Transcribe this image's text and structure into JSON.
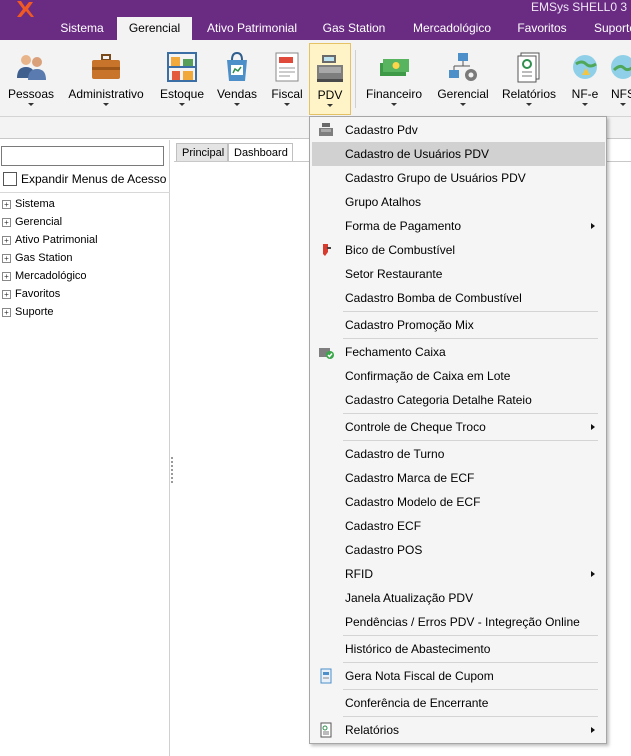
{
  "window": {
    "title": "EMSys SHELL0 3"
  },
  "tabs": [
    {
      "label": "Sistema",
      "active": false
    },
    {
      "label": "Gerencial",
      "active": true
    },
    {
      "label": "Ativo Patrimonial",
      "active": false
    },
    {
      "label": "Gas Station",
      "active": false
    },
    {
      "label": "Mercadológico",
      "active": false
    },
    {
      "label": "Favoritos",
      "active": false
    },
    {
      "label": "Suporte",
      "active": false
    }
  ],
  "ribbon": [
    {
      "label": "Pessoas",
      "icon": "people-icon"
    },
    {
      "label": "Administrativo",
      "icon": "briefcase-icon"
    },
    {
      "label": "Estoque",
      "icon": "shelves-icon"
    },
    {
      "label": "Vendas",
      "icon": "sales-bag-icon"
    },
    {
      "label": "Fiscal",
      "icon": "tax-document-icon"
    },
    {
      "label": "PDV",
      "icon": "cash-register-icon",
      "selected": true
    },
    {
      "label": "Financeiro",
      "icon": "money-icon"
    },
    {
      "label": "Gerencial",
      "icon": "network-gear-icon"
    },
    {
      "label": "Relatórios",
      "icon": "report-icon"
    },
    {
      "label": "NF-e",
      "icon": "nfe-icon"
    },
    {
      "label": "NFS",
      "icon": "nfs-icon"
    }
  ],
  "left_panel": {
    "search_value": "",
    "expand_label": "Expandir Menus de Acesso",
    "tree": [
      "Sistema",
      "Gerencial",
      "Ativo Patrimonial",
      "Gas Station",
      "Mercadológico",
      "Favoritos",
      "Suporte"
    ]
  },
  "doc_tabs": [
    "Principal",
    "Dashboard"
  ],
  "pdv_menu": [
    {
      "label": "Cadastro Pdv",
      "icon": "cash-register-icon"
    },
    {
      "label": "Cadastro de Usuários PDV",
      "highlighted": true
    },
    {
      "label": "Cadastro Grupo de Usuários PDV"
    },
    {
      "label": "Grupo Atalhos"
    },
    {
      "label": "Forma de Pagamento",
      "submenu": true
    },
    {
      "label": "Bico de Combustível",
      "icon": "fuel-nozzle-icon"
    },
    {
      "label": "Setor Restaurante"
    },
    {
      "label": "Cadastro Bomba de Combustível"
    },
    {
      "label": "Cadastro Promoção Mix"
    },
    {
      "label": "Fechamento Caixa",
      "icon": "register-check-icon"
    },
    {
      "label": "Confirmação de Caixa em Lote"
    },
    {
      "label": "Cadastro Categoria Detalhe Rateio"
    },
    {
      "label": "Controle de Cheque Troco",
      "submenu": true
    },
    {
      "label": "Cadastro de Turno"
    },
    {
      "label": "Cadastro Marca de ECF"
    },
    {
      "label": "Cadastro Modelo de ECF"
    },
    {
      "label": "Cadastro ECF"
    },
    {
      "label": "Cadastro POS"
    },
    {
      "label": "RFID",
      "submenu": true
    },
    {
      "label": "Janela Atualização PDV"
    },
    {
      "label": "Pendências / Erros PDV - Integreção Online"
    },
    {
      "label": "Histórico de Abastecimento"
    },
    {
      "label": "Gera Nota Fiscal de Cupom",
      "icon": "receipt-icon"
    },
    {
      "label": "Conferência de Encerrante"
    },
    {
      "label": "Relatórios",
      "icon": "report-icon",
      "submenu": true
    }
  ],
  "colors": {
    "titlebar": "#6a2c83",
    "ribbon": "#f3f3f3",
    "menu_highlight": "#d1d1d1",
    "selected_button": "#fff4c8"
  }
}
